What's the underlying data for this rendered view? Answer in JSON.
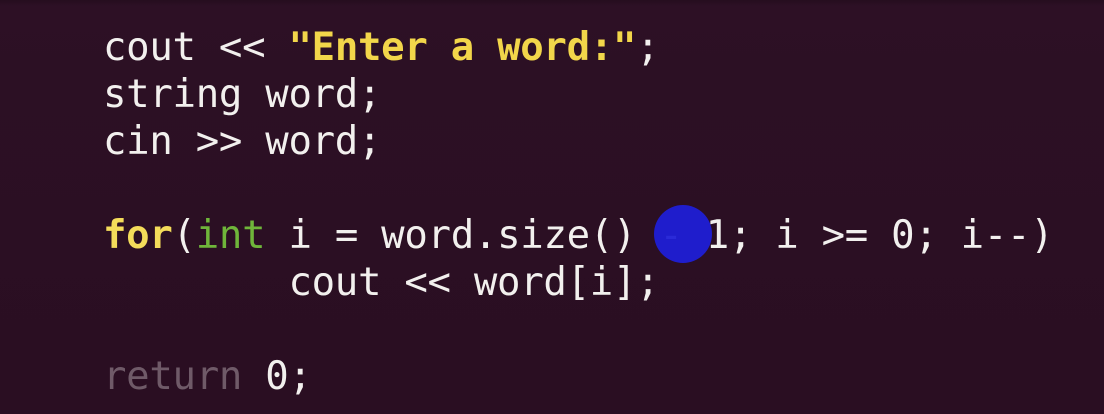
{
  "editor": {
    "lines": [
      {
        "segments": [
          {
            "text": "cout << ",
            "kind": "plain"
          },
          {
            "text": "\"Enter a word:\"",
            "kind": "string"
          },
          {
            "text": ";",
            "kind": "plain"
          }
        ]
      },
      {
        "segments": [
          {
            "text": "string word;",
            "kind": "plain"
          }
        ]
      },
      {
        "segments": [
          {
            "text": "cin >> word;",
            "kind": "plain"
          }
        ]
      },
      {
        "segments": [
          {
            "text": "",
            "kind": "plain"
          }
        ]
      },
      {
        "segments": [
          {
            "text": "for",
            "kind": "keyword"
          },
          {
            "text": "(",
            "kind": "plain"
          },
          {
            "text": "int",
            "kind": "type"
          },
          {
            "text": " i = word.size() - 1; i >= 0; i--)",
            "kind": "plain"
          }
        ]
      },
      {
        "segments": [
          {
            "text": "        cout << word[i];",
            "kind": "plain"
          }
        ]
      },
      {
        "segments": [
          {
            "text": "",
            "kind": "plain"
          }
        ]
      },
      {
        "segments": [
          {
            "text": "return",
            "kind": "return"
          },
          {
            "text": " 0;",
            "kind": "plain"
          }
        ]
      }
    ],
    "colors": {
      "background": "#2c0f24",
      "text": "#f2f0ee",
      "string": "#f2d64a",
      "keyword": "#f4dc5a",
      "type": "#6fb53a",
      "return_keyword": "#6f5a68",
      "cursor_highlight": "#1f1fd6"
    },
    "cursor_icon": "blue-circle-cursor-icon"
  }
}
